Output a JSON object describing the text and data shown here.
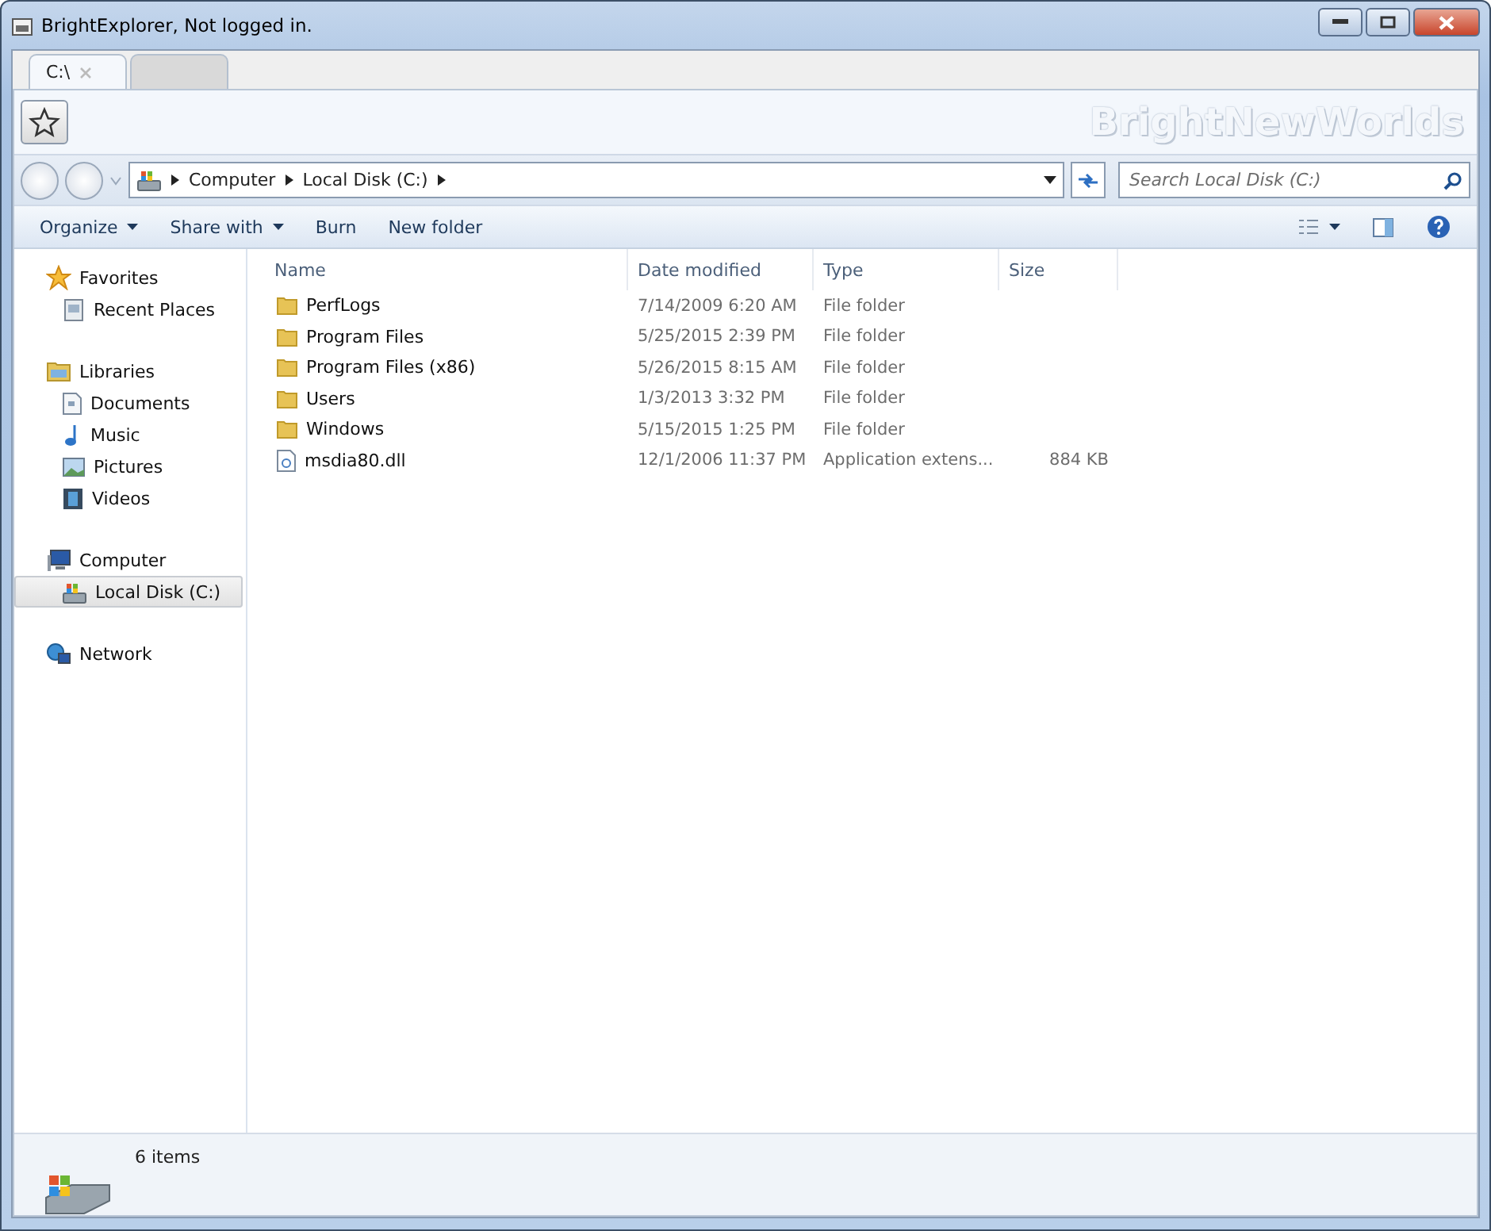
{
  "window": {
    "title": "BrightExplorer, Not logged in."
  },
  "tabs": [
    {
      "label": "C:\\",
      "selected": true
    },
    {
      "selected": false
    }
  ],
  "brand": "BrightNewWorlds",
  "address": {
    "crumbs": [
      "Computer",
      "Local Disk (C:)"
    ]
  },
  "search": {
    "placeholder": "Search Local Disk (C:)"
  },
  "commands": [
    {
      "label": "Organize",
      "dropdown": true
    },
    {
      "label": "Share with",
      "dropdown": true
    },
    {
      "label": "Burn",
      "dropdown": false
    },
    {
      "label": "New folder",
      "dropdown": false
    }
  ],
  "sidebar": {
    "groups": [
      {
        "label": "Favorites",
        "children": [
          {
            "label": "Recent Places",
            "selected": false
          }
        ]
      },
      {
        "label": "Libraries",
        "children": [
          {
            "label": "Documents",
            "selected": false
          },
          {
            "label": "Music",
            "selected": false
          },
          {
            "label": "Pictures",
            "selected": false
          },
          {
            "label": "Videos",
            "selected": false
          }
        ]
      },
      {
        "label": "Computer",
        "children": [
          {
            "label": "Local Disk (C:)",
            "selected": true
          }
        ]
      },
      {
        "label": "Network"
      }
    ]
  },
  "table": {
    "columns": [
      "Name",
      "Date modified",
      "Type",
      "Size"
    ],
    "rows": [
      {
        "kind": "folder",
        "name": "PerfLogs",
        "date": "7/14/2009 6:20 AM",
        "type": "File folder"
      },
      {
        "kind": "folder",
        "name": "Program Files",
        "date": "5/25/2015 2:39 PM",
        "type": "File folder"
      },
      {
        "kind": "folder",
        "name": "Program Files (x86)",
        "date": "5/26/2015 8:15 AM",
        "type": "File folder"
      },
      {
        "kind": "folder",
        "name": "Users",
        "date": "1/3/2013 3:32 PM",
        "type": "File folder"
      },
      {
        "kind": "folder",
        "name": "Windows",
        "date": "5/15/2015 1:25 PM",
        "type": "File folder"
      },
      {
        "kind": "file",
        "name": "msdia80.dll",
        "date": "12/1/2006 11:37 PM",
        "type": "Application extens...",
        "size": "884 KB"
      }
    ]
  },
  "status_bar": {
    "count": "6 items"
  }
}
